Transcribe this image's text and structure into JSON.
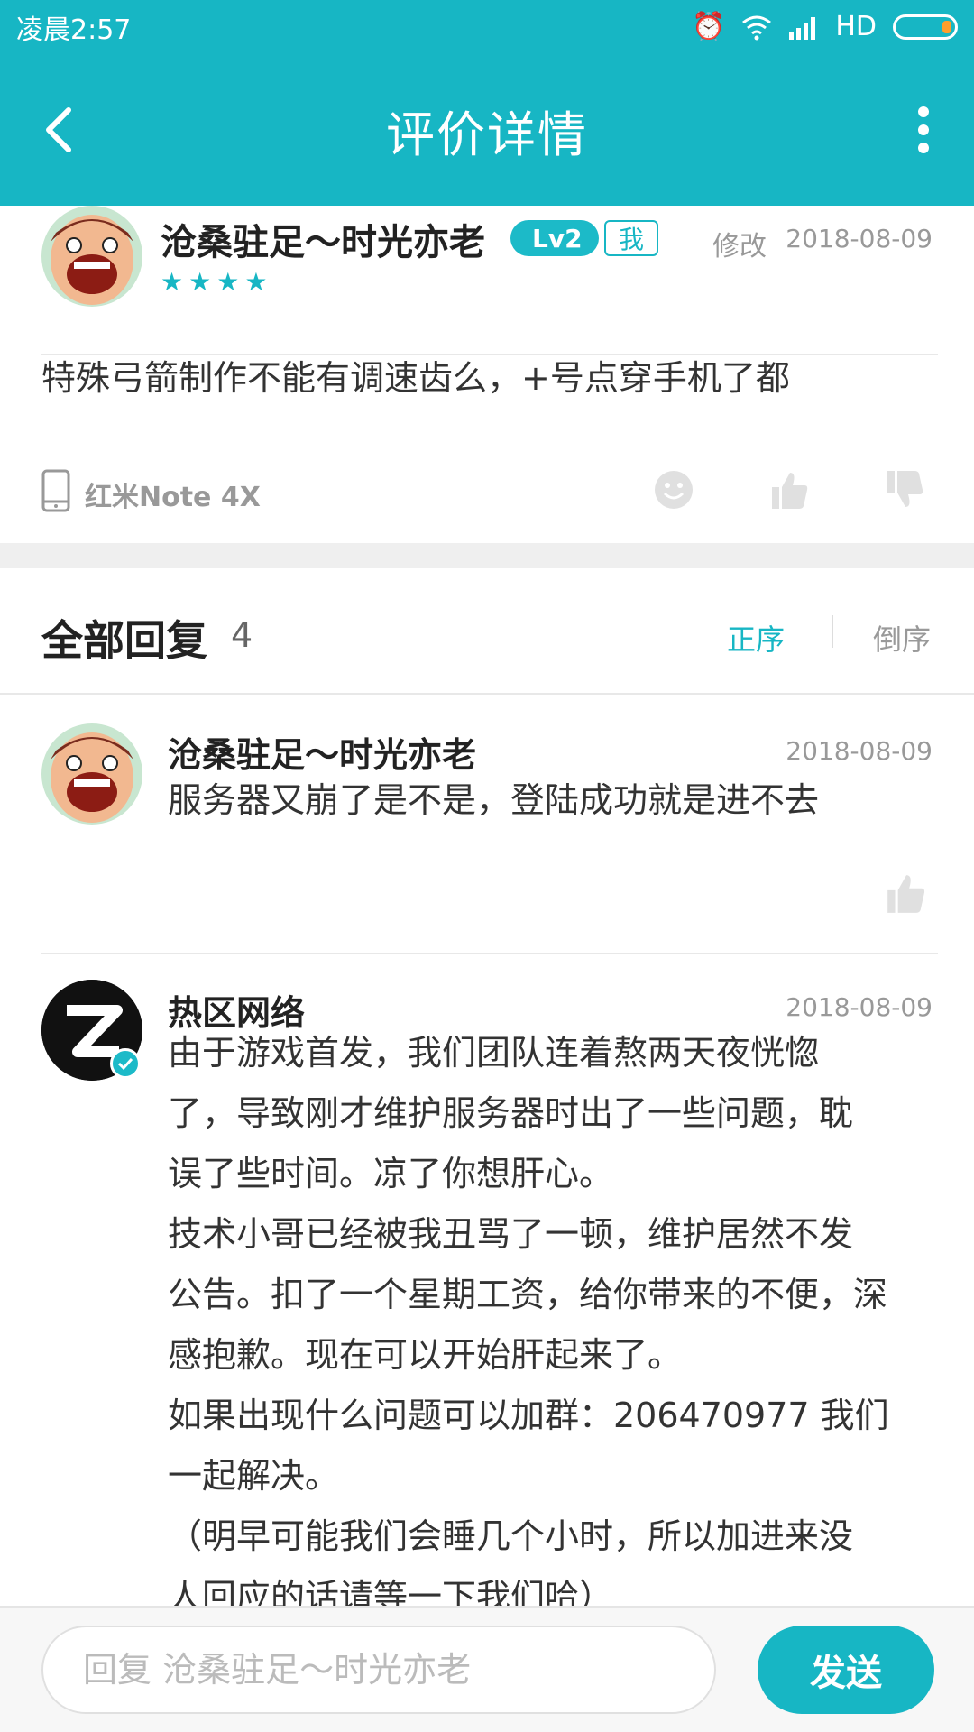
{
  "status_bar": {
    "time": "凌晨2:57",
    "network": "HD"
  },
  "header": {
    "title": "评价详情"
  },
  "review": {
    "author": "沧桑驻足～时光亦老",
    "level": "Lv2",
    "me_badge": "我",
    "edit": "修改",
    "date": "2018-08-09",
    "stars": 4,
    "text": "特殊弓箭制作不能有调速齿么，+号点穿手机了都",
    "device": "红米Note 4X"
  },
  "replies": {
    "title": "全部回复",
    "count": "4",
    "sort_asc": "正序",
    "sort_desc": "倒序",
    "items": [
      {
        "author": "沧桑驻足～时光亦老",
        "date": "2018-08-09",
        "text": "服务器又崩了是不是，登陆成功就是进不去"
      },
      {
        "author": "热区网络",
        "date": "2018-08-09",
        "lines": [
          "由于游戏首发，我们团队连着熬两天夜恍惚",
          "了，导致刚才维护服务器时出了一些问题，耽",
          "误了些时间。凉了你想肝心。",
          "技术小哥已经被我丑骂了一顿，维护居然不发",
          "公告。扣了一个星期工资，给你带来的不便，深",
          "感抱歉。现在可以开始肝起来了。",
          "如果出现什么问题可以加群：206470977 我们",
          "一起解决。",
          "（明早可能我们会睡几个小时，所以加进来没",
          "人回应的话请等一下我们哈）"
        ]
      }
    ]
  },
  "reply_bar": {
    "placeholder": "回复 沧桑驻足～时光亦老",
    "send": "发送"
  },
  "colors": {
    "accent": "#17b6c4"
  }
}
